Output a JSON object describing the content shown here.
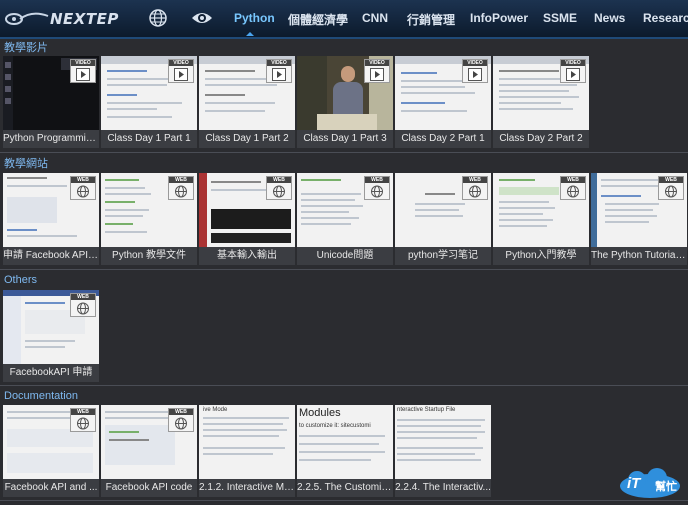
{
  "brand": {
    "logo_text": "NEXTEP"
  },
  "nav": {
    "tabs": [
      {
        "label": "Python",
        "active": true
      },
      {
        "label": "個體經濟學"
      },
      {
        "label": "CNN"
      },
      {
        "label": "行銷管理"
      },
      {
        "label": "InfoPower"
      },
      {
        "label": "SSME"
      },
      {
        "label": "News"
      },
      {
        "label": "Research"
      }
    ]
  },
  "sections": [
    {
      "title": "教學影片",
      "badge": "VIDEO",
      "items": [
        {
          "caption": "Python Programming..."
        },
        {
          "caption": "Class Day 1 Part 1"
        },
        {
          "caption": "Class Day 1 Part 2"
        },
        {
          "caption": "Class Day 1 Part 3"
        },
        {
          "caption": "Class Day 2 Part 1"
        },
        {
          "caption": "Class Day 2 Part 2"
        }
      ]
    },
    {
      "title": "教學網站",
      "badge": "WEB",
      "items": [
        {
          "caption": "申請 Facebook API ..."
        },
        {
          "caption": "Python 教學文件"
        },
        {
          "caption": "基本輸入輸出"
        },
        {
          "caption": "Unicode問題"
        },
        {
          "caption": "python学习笔记"
        },
        {
          "caption": "Python入門教學"
        },
        {
          "caption": "The Python Tutorial ..."
        }
      ]
    },
    {
      "title": "Others",
      "badge": "WEB",
      "items": [
        {
          "caption": "FacebookAPI 申請"
        }
      ]
    },
    {
      "title": "Documentation",
      "badge": "WEB",
      "items": [
        {
          "caption": "Facebook API and ..."
        },
        {
          "caption": "Facebook API code"
        },
        {
          "caption": "2.1.2. Interactive Mo..."
        },
        {
          "caption": "2.2.5. The Customiz..."
        },
        {
          "caption": "2.2.4. The Interactiv..."
        }
      ]
    }
  ],
  "thumb_text": {
    "d2_1_heading": "ive Mode",
    "d2_2_heading": "Modules",
    "d2_3_heading": "nteractive Startup File",
    "d2_2_line": "to customize it: sitecustomi"
  },
  "watermark": {
    "text": "iT",
    "sub": "幫忙"
  },
  "colors": {
    "accent": "#79c8ff",
    "section_title": "#7fb9f0",
    "background": "#2b2c30"
  }
}
